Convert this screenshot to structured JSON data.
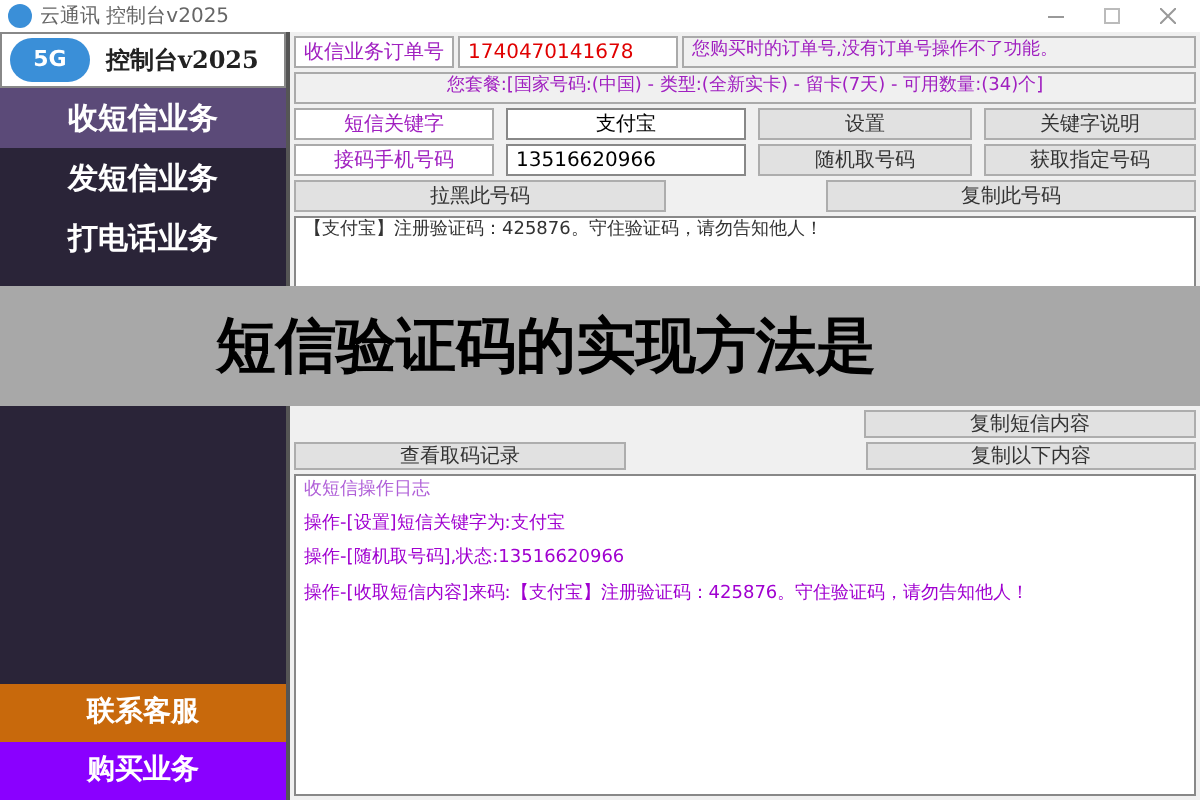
{
  "window": {
    "title": "云通讯 控制台v2025"
  },
  "sidebar": {
    "logo_badge": "5G",
    "brand": "控制台v2025",
    "items": [
      {
        "label": "收短信业务",
        "selected": true
      },
      {
        "label": "发短信业务",
        "selected": false
      },
      {
        "label": "打电话业务",
        "selected": false
      }
    ],
    "bottom_buttons": [
      {
        "label": "联系客服",
        "color": "#c8690c"
      },
      {
        "label": "购买业务",
        "color": "#8a00ff"
      }
    ]
  },
  "order": {
    "label": "收信业务订单号",
    "value": "1740470141678",
    "hint": "您购买时的订单号,没有订单号操作不了功能。"
  },
  "package": "您套餐:[国家号码:(中国) - 类型:(全新实卡) - 留卡(7天) - 可用数量:(34)个]",
  "keyword": {
    "label": "短信关键字",
    "value": "支付宝",
    "buttons": [
      "设置",
      "关键字说明"
    ]
  },
  "phone": {
    "label": "接码手机号码",
    "value": "13516620966",
    "buttons": [
      "随机取号码",
      "获取指定号码"
    ]
  },
  "number_buttons": [
    "拉黑此号码",
    "复制此号码"
  ],
  "message": "【支付宝】注册验证码：425876。守住验证码，请勿告知他人！",
  "banner": "短信验证码的实现方法是",
  "message_buttons": [
    "复制短信内容"
  ],
  "record_buttons": [
    "查看取码记录",
    "复制以下内容"
  ],
  "log": {
    "title": "收短信操作日志",
    "lines": [
      "操作-[设置]短信关键字为:支付宝",
      "操作-[随机取号码],状态:13516620966",
      "操作-[收取短信内容]来码:【支付宝】注册验证码：425876。守住验证码，请勿告知他人！"
    ]
  }
}
